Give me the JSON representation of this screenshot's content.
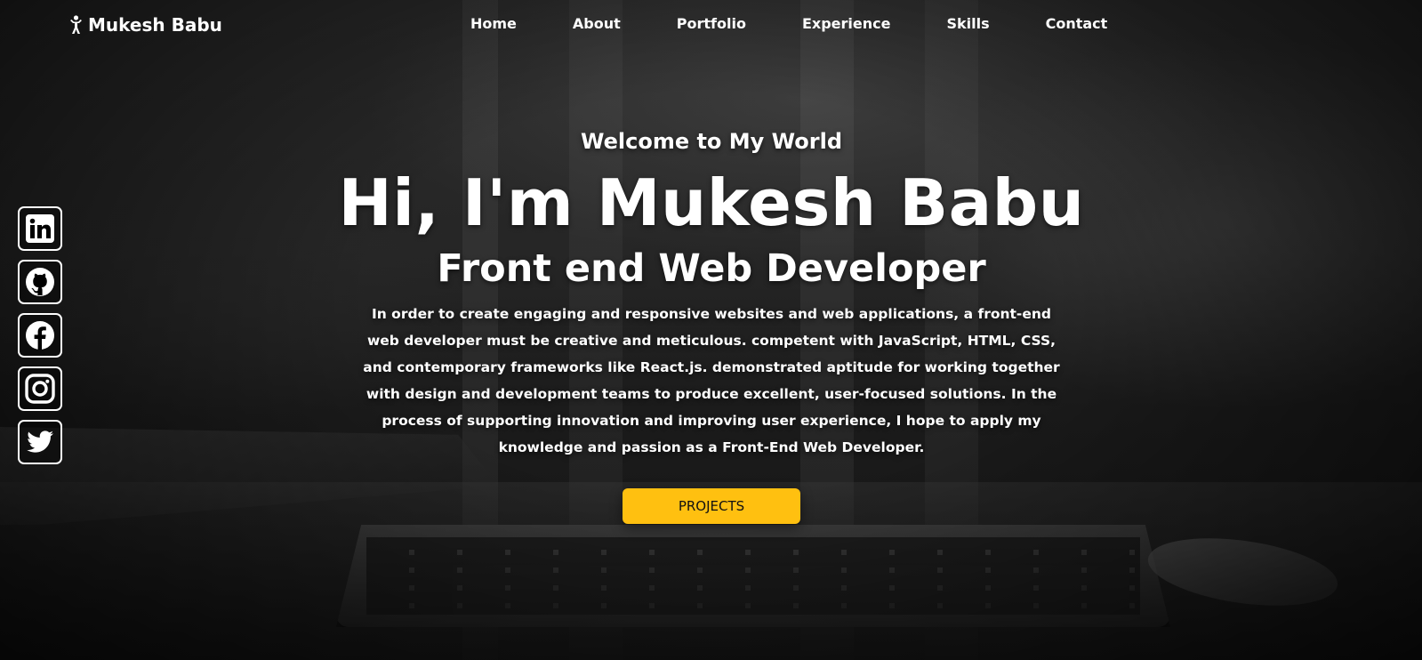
{
  "brand": {
    "name": "Mukesh Babu",
    "icon": "person-icon"
  },
  "nav": {
    "items": [
      {
        "label": "Home"
      },
      {
        "label": "About"
      },
      {
        "label": "Portfolio"
      },
      {
        "label": "Experience"
      },
      {
        "label": "Skills"
      },
      {
        "label": "Contact"
      }
    ]
  },
  "social": {
    "items": [
      {
        "icon": "linkedin-icon"
      },
      {
        "icon": "github-icon"
      },
      {
        "icon": "facebook-icon"
      },
      {
        "icon": "instagram-icon"
      },
      {
        "icon": "twitter-icon"
      }
    ]
  },
  "hero": {
    "welcome": "Welcome to My World",
    "title": "Hi, I'm Mukesh Babu",
    "subtitle": "Front end Web Developer",
    "description": "In order to create engaging and responsive websites and web applications, a front-end web developer must be creative and meticulous. competent with JavaScript, HTML, CSS, and contemporary frameworks like React.js. demonstrated aptitude for working together with design and development teams to produce excellent, user-focused solutions. In the process of supporting innovation and improving user experience, I hope to apply my knowledge and passion as a Front-End Web Developer.",
    "cta_label": "PROJECTS"
  },
  "colors": {
    "accent": "#ffc010",
    "text": "#ffffff"
  }
}
